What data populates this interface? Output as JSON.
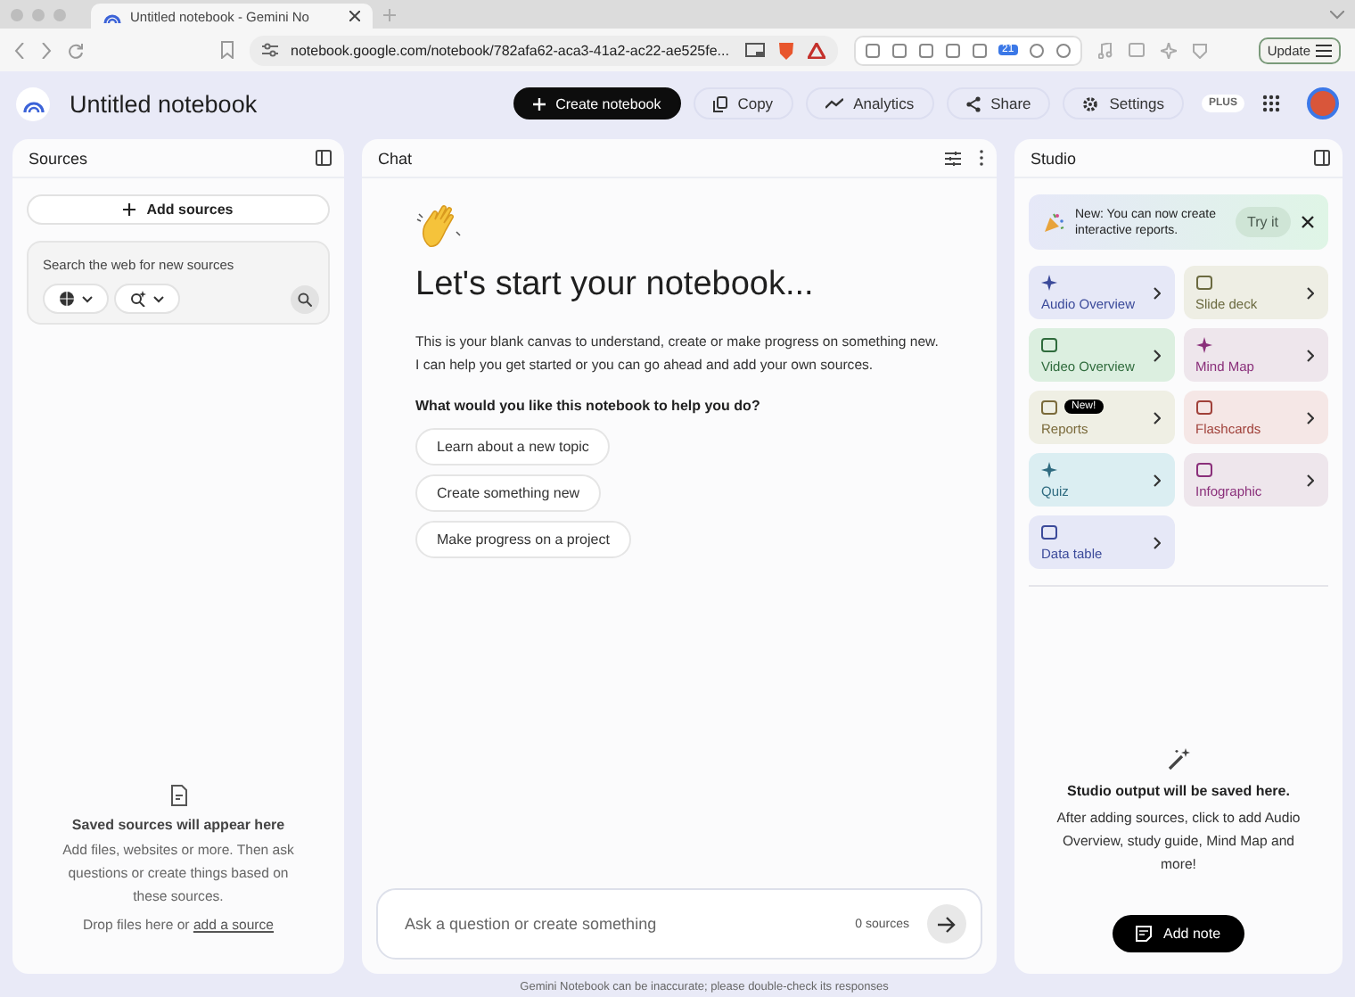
{
  "browser": {
    "tab_title": "Untitled notebook - Gemini No",
    "url": "notebook.google.com/notebook/782afa62-aca3-41a2-ac22-ae525fe...",
    "calendar_badge": "21",
    "update_button": "Update"
  },
  "header": {
    "title": "Untitled notebook",
    "buttons": [
      {
        "label": "Create notebook",
        "kind": "primary"
      },
      {
        "label": "Copy",
        "kind": "copy"
      },
      {
        "label": "Analytics",
        "kind": "analytics"
      },
      {
        "label": "Share",
        "kind": "share"
      },
      {
        "label": "Settings",
        "kind": "settings"
      }
    ],
    "plan_badge": "PLUS"
  },
  "sources": {
    "title": "Sources",
    "add_button": "Add sources",
    "search": {
      "placeholder": "Search the web for new sources"
    },
    "empty": {
      "title": "Saved sources will appear here",
      "text": "Add files, websites or more. Then ask questions or create things based on these sources.",
      "drop_text": "Drop files here or",
      "link": "add a source"
    }
  },
  "chat": {
    "title": "Chat",
    "heading": "Let's start your notebook...",
    "intro": [
      "This is your blank canvas to understand, create or make progress on something new.",
      "I can help you get started or you can go ahead and add your own sources."
    ],
    "question": "What would you like this notebook to help you do?",
    "suggestions": [
      "Learn about a new topic",
      "Create something new",
      "Make progress on a project"
    ],
    "input": {
      "placeholder": "Ask a question or create something",
      "source_count": "0 sources"
    }
  },
  "studio": {
    "title": "Studio",
    "banner": {
      "text": "New: You can now create interactive reports.",
      "button": "Try it"
    },
    "tiles": [
      {
        "label": "Audio Overview",
        "color": "#e6e8f7"
      },
      {
        "label": "Slide deck",
        "color": "#eeeee4"
      },
      {
        "label": "Video Overview",
        "color": "#dcefe0"
      },
      {
        "label": "Mind Map",
        "color": "#eee6ec"
      },
      {
        "label": "Reports",
        "color": "#efefe4",
        "badge": "New!"
      },
      {
        "label": "Flashcards",
        "color": "#f5e7e6"
      },
      {
        "label": "Quiz",
        "color": "#dbeef2"
      },
      {
        "label": "Infographic",
        "color": "#eee6ec"
      },
      {
        "label": "Data table",
        "color": "#e6e8f7"
      }
    ],
    "empty": {
      "title": "Studio output will be saved here.",
      "text": "After adding sources, click to add Audio Overview, study guide, Mind Map and more!"
    },
    "add_note": "Add note"
  },
  "footer": "Gemini Notebook can be inaccurate; please double-check its responses"
}
